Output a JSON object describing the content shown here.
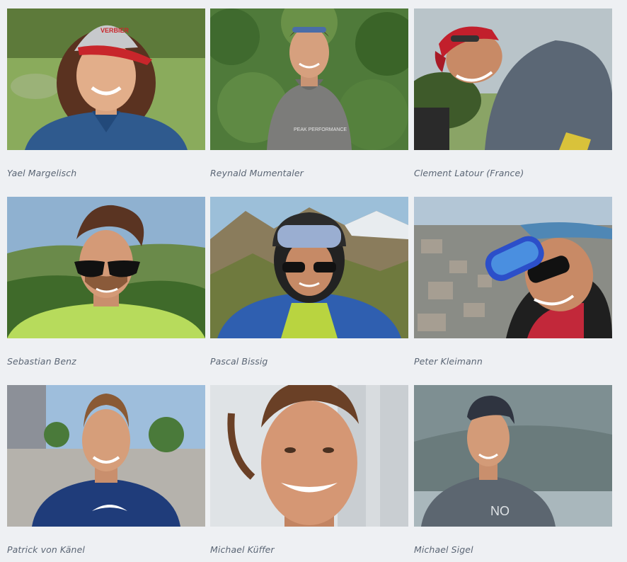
{
  "team": {
    "members": [
      {
        "name": "Yael Margelisch",
        "photo": "portrait with red cap, meadow background"
      },
      {
        "name": "Reynald Mumentaler",
        "photo": "portrait with grey hoodie, green leaves background"
      },
      {
        "name": "Clement Latour (France)",
        "photo": "portrait with red cap, grey t-shirt, outdoor"
      },
      {
        "name": "Sebastian Benz",
        "photo": "selfie with sunglasses, hills background"
      },
      {
        "name": "Pascal Bissig",
        "photo": "selfie with helmet and goggles, mountains background"
      },
      {
        "name": "Peter Kleimann",
        "photo": "selfie with goggles, aerial city view"
      },
      {
        "name": "Patrick von Känel",
        "photo": "portrait in navy sweater, street background"
      },
      {
        "name": "Michael Küffer",
        "photo": "close-up smiling portrait"
      },
      {
        "name": "Michael Sigel",
        "photo": "portrait with cap, lake background"
      }
    ],
    "shirt_prints": {
      "reynald": "PEAK PERFORMANCE",
      "sigel": "NO"
    },
    "cap_prints": {
      "yael": "VERBIER"
    }
  },
  "colors": {
    "page_bg": "#eef0f3",
    "name_text": "#5b6675"
  }
}
